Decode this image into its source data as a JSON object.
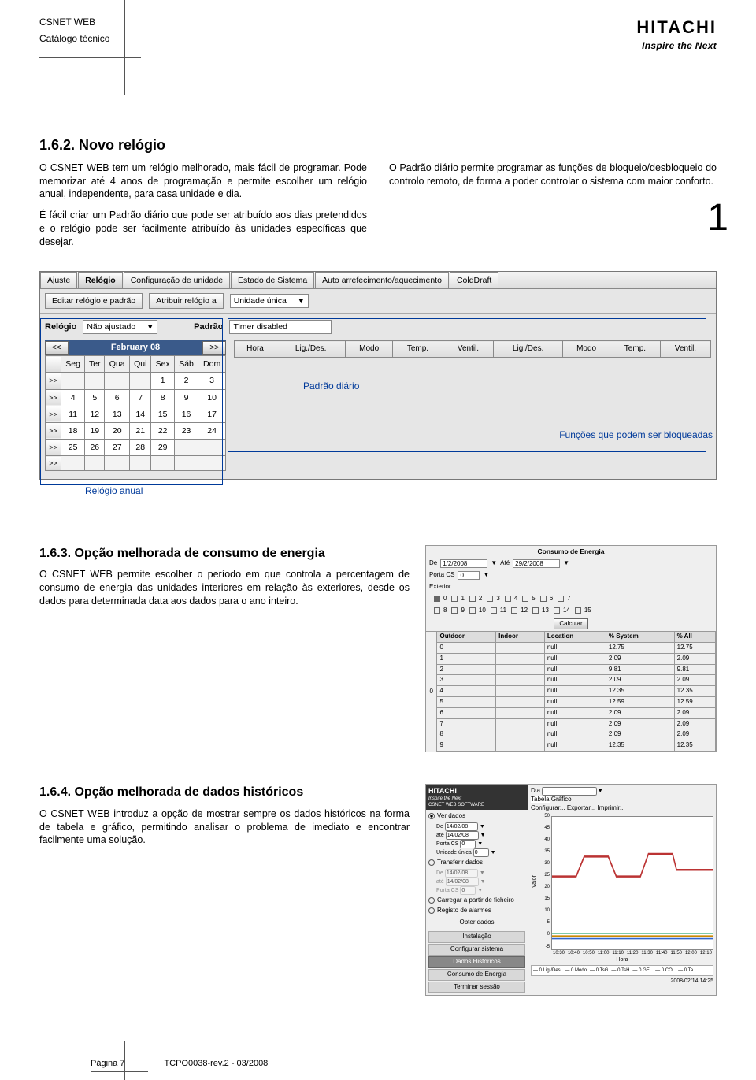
{
  "header": {
    "title": "CSNET WEB",
    "subtitle": "Catálogo técnico",
    "logo": "HITACHI",
    "tagline": "Inspire the Next"
  },
  "pageNumBig": "1",
  "s162": {
    "heading": "1.6.2.  Novo relógio",
    "p1": "O CSNET WEB tem um relógio melhorado, mais fácil de programar. Pode memorizar até 4 anos de programação e permite escolher um relógio anual, independente, para casa unidade e dia.",
    "p2": "É fácil criar um Padrão diário que pode ser atribuído aos dias pretendidos e o relógio pode ser facilmente atribuído às unidades específicas que desejar.",
    "p3": "O Padrão diário permite programar as funções de bloqueio/desbloqueio do controlo remoto, de forma a poder controlar o sistema com maior conforto."
  },
  "sshot1": {
    "tabs": [
      "Ajuste",
      "Relógio",
      "Configuração de unidade",
      "Estado de Sistema",
      "Auto arrefecimento/aquecimento",
      "ColdDraft"
    ],
    "subtabs": [
      "Editar relógio e padrão",
      "Atribuir relógio a"
    ],
    "unitSelect": "Unidade única",
    "relogioLabel": "Relógio",
    "relogioValue": "Não ajustado",
    "padraoLabel": "Padrão",
    "padraoValue": "Timer disabled",
    "month": "February 08",
    "prev": "<<",
    "next": ">>",
    "weekdays": [
      "Seg",
      "Ter",
      "Qua",
      "Qui",
      "Sex",
      "Sáb",
      "Dom"
    ],
    "prefix": ">>",
    "weeks": [
      [
        "",
        "",
        "",
        "",
        "1",
        "2",
        "3"
      ],
      [
        "4",
        "5",
        "6",
        "7",
        "8",
        "9",
        "10"
      ],
      [
        "11",
        "12",
        "13",
        "14",
        "15",
        "16",
        "17"
      ],
      [
        "18",
        "19",
        "20",
        "21",
        "22",
        "23",
        "24"
      ],
      [
        "25",
        "26",
        "27",
        "28",
        "29",
        "",
        ""
      ],
      [
        "",
        "",
        "",
        "",
        "",
        "",
        ""
      ]
    ],
    "timeHeaders": [
      "Hora",
      "Lig./Des.",
      "Modo",
      "Temp.",
      "Ventil.",
      "Lig./Des.",
      "Modo",
      "Temp.",
      "Ventil."
    ],
    "anno1": "Padrão diário",
    "anno2": "Funções que podem ser bloqueadas",
    "anno3": "Relógio anual"
  },
  "s163": {
    "heading": "1.6.3.  Opção melhorada de consumo de energia",
    "p1": "O CSNET WEB permite escolher o período em que controla a percentagem de consumo de energia das unidades interiores em relação às exteriores, desde os dados para determinada data aos dados para o ano inteiro."
  },
  "mini2": {
    "title": "Consumo de Energia",
    "deLabel": "De",
    "de": "1/2/2008",
    "ateLabel": "Até",
    "ate": "29/2/2008",
    "portaLabel": "Porta CS",
    "porta": "0",
    "exteriorLabel": "Exterior",
    "checks": [
      "0",
      "1",
      "2",
      "3",
      "4",
      "5",
      "6",
      "7",
      "8",
      "9",
      "10",
      "11",
      "12",
      "13",
      "14",
      "15"
    ],
    "calcBtn": "Calcular",
    "cols": [
      "Outdoor",
      "Indoor",
      "Location",
      "% System",
      "% All"
    ],
    "rows": [
      [
        "0",
        "",
        "null",
        "12.75",
        "12.75"
      ],
      [
        "1",
        "",
        "null",
        "2.09",
        "2.09"
      ],
      [
        "2",
        "",
        "null",
        "9.81",
        "9.81"
      ],
      [
        "3",
        "",
        "null",
        "2.09",
        "2.09"
      ],
      [
        "4",
        "",
        "null",
        "12.35",
        "12.35"
      ],
      [
        "5",
        "",
        "null",
        "12.59",
        "12.59"
      ],
      [
        "6",
        "",
        "null",
        "2.09",
        "2.09"
      ],
      [
        "7",
        "",
        "null",
        "2.09",
        "2.09"
      ],
      [
        "8",
        "",
        "null",
        "2.09",
        "2.09"
      ],
      [
        "9",
        "",
        "null",
        "12.35",
        "12.35"
      ]
    ],
    "sideZero": "0"
  },
  "s164": {
    "heading": "1.6.4.  Opção melhorada de dados históricos",
    "p1": "O CSNET WEB introduz a opção de mostrar sempre os dados históricos na forma de tabela e gráfico, permitindo analisar o problema de imediato e encontrar facilmente uma solução."
  },
  "mini3": {
    "brand": "HITACHI",
    "brand2": "Inspire the Next",
    "subtitle": "CSNET WEB SOFTWARE",
    "leftItems": {
      "radios": [
        {
          "label": "Ver dados",
          "on": true
        },
        {
          "label": "Transferir dados",
          "on": false
        },
        {
          "label": "Carregar a partir de ficheiro",
          "on": false
        },
        {
          "label": "Registo de alarmes",
          "on": false
        }
      ],
      "de": "De",
      "deVal": "14/02/08",
      "ate": "até",
      "ateVal": "14/02/08",
      "porta": "Porta CS",
      "portaVal": "0",
      "unidade": "Unidade única",
      "unidadeVal": "0",
      "de2": "De",
      "de2Val": "14/02/08",
      "ate2": "até",
      "ate2Val": "14/02/08",
      "porta2": "Porta CS",
      "porta2Val": "0",
      "btn": "Obter dados",
      "bottom": [
        "Instalação",
        "Configurar sistema",
        "Dados Históricos",
        "Consumo de Energia",
        "Terminar sessão"
      ]
    },
    "right": {
      "diaLabel": "Dia",
      "tabs": [
        "Tabela",
        "Gráfico"
      ],
      "btns": [
        "Configurar...",
        "Exportar...",
        "Imprimir..."
      ],
      "yTicks": [
        "50",
        "45",
        "40",
        "35",
        "30",
        "25",
        "20",
        "15",
        "10",
        "5",
        "0",
        "-5"
      ],
      "yLabel": "Valor",
      "xTicks": [
        "10:30",
        "10:40",
        "10:50",
        "11:00",
        "11:10",
        "11:20",
        "11:30",
        "11:40",
        "11:50",
        "12:00",
        "12:10"
      ],
      "xLabel": "Hora",
      "legend": [
        "0.Lig./Des.",
        "0.Modo",
        "0.TsG",
        "0.TsH",
        "0.GEL",
        "0.COL",
        "0.Ta"
      ],
      "timestamp": "2008/02/14 14:25"
    }
  },
  "footer": {
    "page": "Página 7",
    "doc": "TCPO0038-rev.2 - 03/2008"
  }
}
